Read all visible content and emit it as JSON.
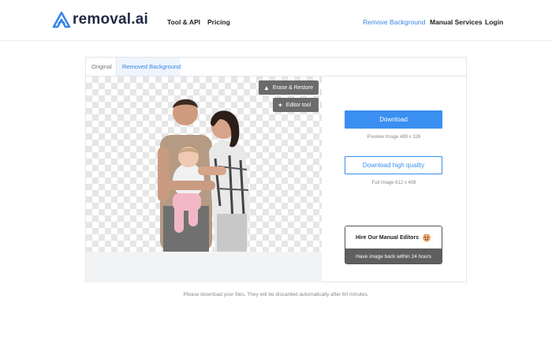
{
  "header": {
    "logo_text": "removal.ai",
    "nav_left": [
      "Tool & API",
      "Pricing"
    ],
    "nav_right": {
      "remove_background": "Remove Background",
      "manual_services": "Manual Services",
      "login": "Login"
    },
    "active_color": "#3a86e8"
  },
  "editor": {
    "tabs": [
      "Original",
      "Removed Background"
    ],
    "active_tab": "Removed Background",
    "erase_restore_label": "Erase & Restore",
    "editor_tool_label": "Editor tool"
  },
  "panel": {
    "download_label": "Download",
    "preview_caption": "Preview Image   489 x 326",
    "download_hq_label": "Download high quality",
    "full_caption": "Full Image   612 x 408",
    "hire_label": "Hire Our Manual Editors",
    "hire_sub_label": "Have image back within 24 hours",
    "primary_color": "#3a8ff0"
  },
  "footer": {
    "note": "Please download your files. They will be discarded automatically after 60 minutes."
  }
}
